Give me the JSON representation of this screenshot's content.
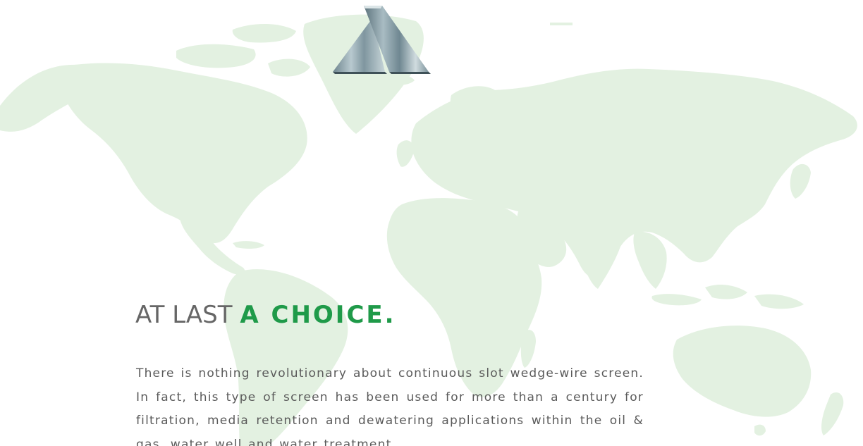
{
  "hero": {
    "headline_plain": "AT LAST",
    "headline_accent": "A CHOICE.",
    "intro_text": "There is nothing revolutionary about continuous slot wedge-wire screen. In fact, this type of screen has been used for more than a century for filtration, media retention and dewatering applications within the oil & gas, water well and water treatment"
  },
  "colors": {
    "map_fill": "#e3f1e1",
    "accent": "#1f9a49",
    "heading_gray": "#666666",
    "body_gray": "#5a5a5a",
    "logo_steel": "#8fa5ad"
  },
  "icons": {
    "logo": "company-logo-steel-triangles",
    "background": "world-map"
  }
}
